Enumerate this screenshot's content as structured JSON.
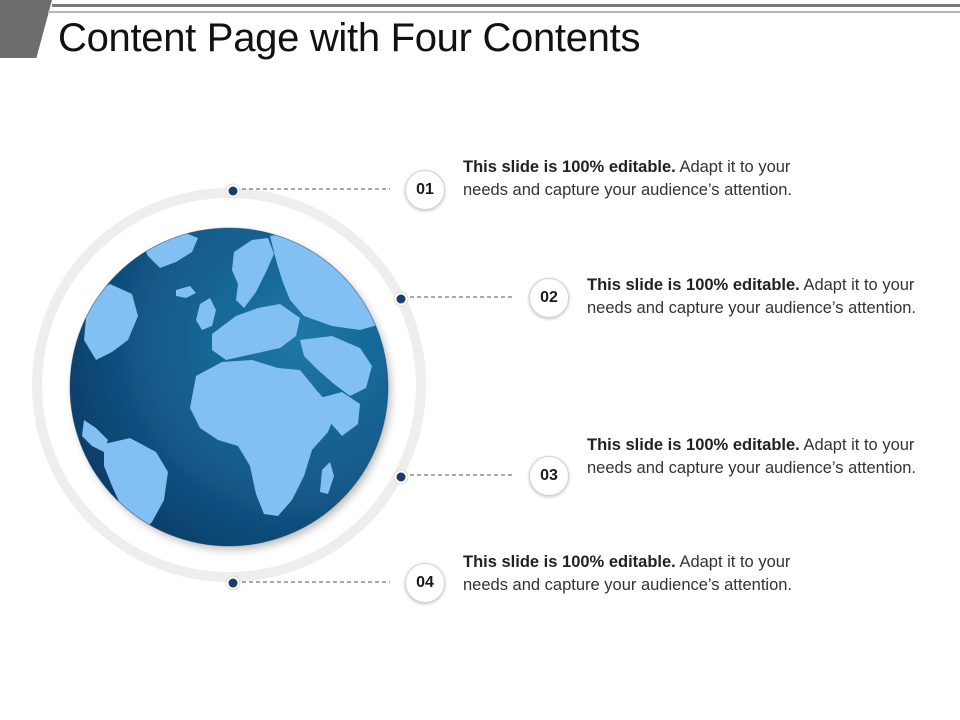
{
  "header": {
    "title": "Content Page with Four Contents"
  },
  "items": [
    {
      "number": "01",
      "bold": "This slide is 100% editable.",
      "rest": " Adapt it to your needs and capture your audience’s attention."
    },
    {
      "number": "02",
      "bold": "This slide is 100% editable.",
      "rest": " Adapt it to your needs and capture your audience’s attention."
    },
    {
      "number": "03",
      "bold": "This slide is 100% editable.",
      "rest": " Adapt it to your needs and capture your audience’s attention."
    },
    {
      "number": "04",
      "bold": "This slide is 100% editable.",
      "rest": " Adapt it to your needs and capture your audience’s attention."
    }
  ],
  "colors": {
    "ocean_dark": "#0f3f6f",
    "ocean_light": "#1a6e9e",
    "land": "#7fbdf2",
    "ring": "#efefef",
    "dot": "#173d6a"
  },
  "icons": {
    "globe": "globe-icon"
  }
}
